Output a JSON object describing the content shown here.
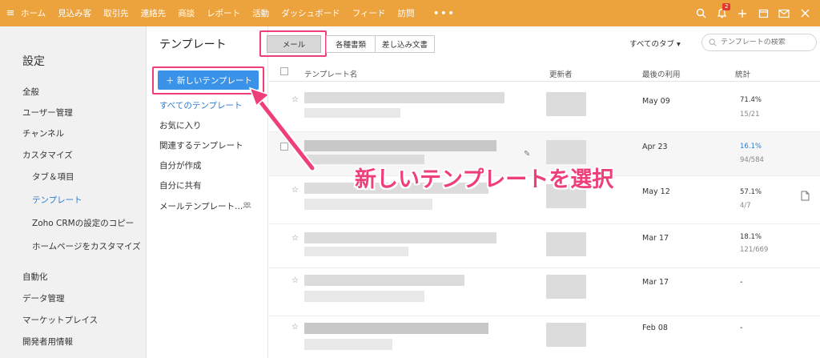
{
  "topnav": {
    "items": [
      "ホーム",
      "見込み客",
      "取引先",
      "連絡先",
      "商談",
      "レポート",
      "活動",
      "ダッシュボード",
      "フィード",
      "訪問"
    ],
    "more": "•••",
    "notification_count": "2"
  },
  "settings": {
    "title": "設定",
    "items": [
      "全般",
      "ユーザー管理",
      "チャンネル",
      "カスタマイズ",
      "タブ＆項目",
      "テンプレート",
      "Zoho CRMの設定のコピー",
      "ホームページをカスタマイズ",
      "自動化",
      "データ管理",
      "マーケットプレイス",
      "開発者用情報"
    ],
    "active": "テンプレート"
  },
  "templates": {
    "heading": "テンプレート",
    "new_button": "＋ 新しいテンプレート",
    "links": [
      "すべてのテンプレート",
      "お気に入り",
      "関連するテンプレート",
      "自分が作成",
      "自分に共有",
      "メールテンプレート..."
    ]
  },
  "tabs": [
    "メール",
    "各種書類",
    "差し込み文書"
  ],
  "type_filter": "すべてのタブ ▾",
  "search": {
    "placeholder": "テンプレートの検索"
  },
  "table": {
    "headers": [
      "テンプレート名",
      "更新者",
      "最後の利用",
      "統計"
    ],
    "rows": [
      {
        "date": "May 09",
        "pct": "71.4%",
        "count": "15/21"
      },
      {
        "date": "Apr 23",
        "pct": "16.1%",
        "count": "94/584"
      },
      {
        "date": "May 12",
        "pct": "57.1%",
        "count": "4/7"
      },
      {
        "date": "Mar 17",
        "pct": "18.1%",
        "count": "121/669"
      },
      {
        "date": "Mar 17",
        "dash": "-"
      },
      {
        "date": "Feb 08",
        "dash": "-"
      }
    ]
  },
  "annotation": "新しいテンプレートを選択",
  "colors": {
    "topbar": "#eda33d",
    "accent": "#3a93e8",
    "highlight": "#ef3f7b",
    "link": "#2e7bcf"
  }
}
